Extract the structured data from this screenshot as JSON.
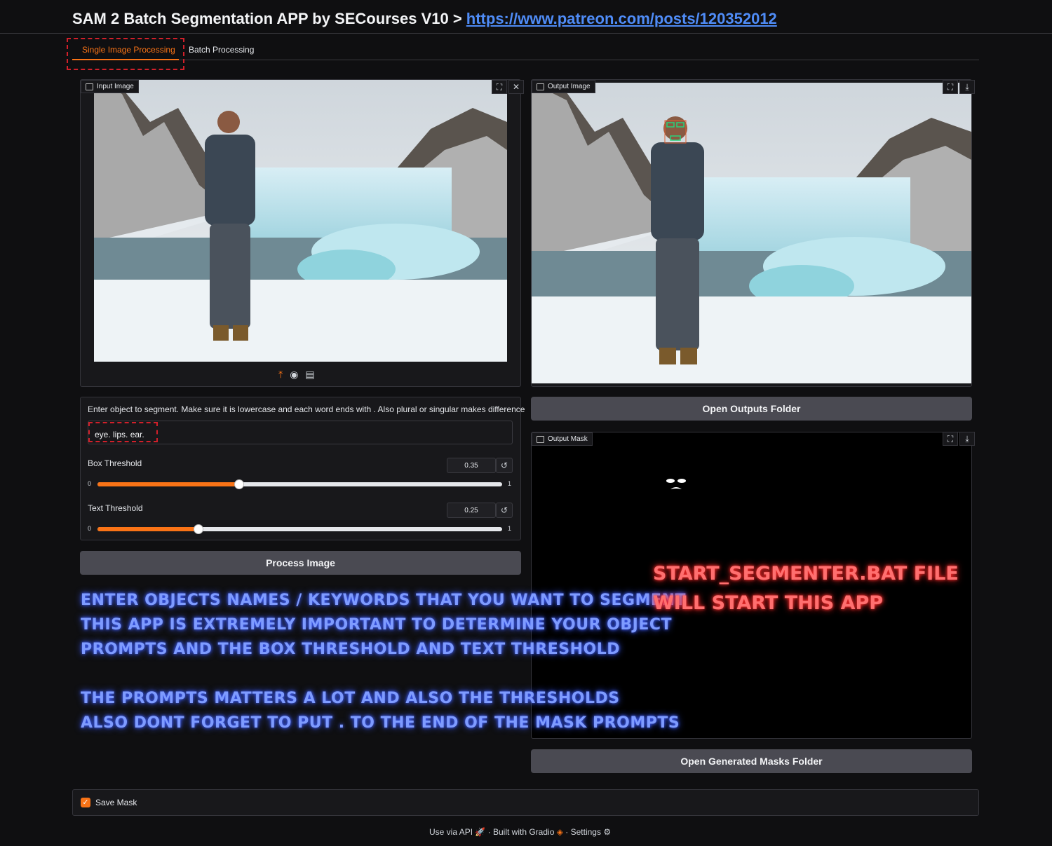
{
  "header": {
    "title": "SAM 2 Batch Segmentation APP by SECourses V10 >",
    "link": "https://www.patreon.com/posts/120352012"
  },
  "tabs": [
    {
      "label": "Single Image Processing",
      "active": true
    },
    {
      "label": "Batch Processing",
      "active": false
    }
  ],
  "input_image": {
    "label": "Input Image",
    "fullscreen_icon": "fullscreen-icon",
    "close_icon": "close-icon",
    "source_icons": [
      "upload-icon",
      "webcam-icon",
      "clipboard-icon"
    ]
  },
  "prompt": {
    "label": "Enter object to segment. Make sure it is lowercase and each word ends with . Also plural or singular makes difference",
    "value": "eye. lips. ear."
  },
  "box_threshold": {
    "label": "Box Threshold",
    "value": "0.35",
    "min": "0",
    "max": "1",
    "fraction": 0.35
  },
  "text_threshold": {
    "label": "Text Threshold",
    "value": "0.25",
    "min": "0",
    "max": "1",
    "fraction": 0.25
  },
  "process_button": "Process Image",
  "output_image": {
    "label": "Output Image"
  },
  "open_outputs_button": "Open Outputs Folder",
  "output_mask": {
    "label": "Output Mask"
  },
  "open_masks_button": "Open Generated Masks Folder",
  "save_mask": {
    "label": "Save Mask",
    "checked": true
  },
  "footer": {
    "api": "Use via API",
    "built": "Built with Gradio",
    "settings": "Settings",
    "separator": "·"
  },
  "annotations": {
    "blue": "Enter objects names / keywords that you want to segment\nthis app is extremely important to determine your object\nprompts and the box threshold and text threshold\n\nthe prompts matters a lot and also the thresholds\nalso dont forget to put . to the end of the mask prompts",
    "red": "start_segmenter.bat file\nwill start this app"
  },
  "colors": {
    "accent": "#f97316",
    "annotation_blue": "#7e9bff",
    "annotation_red": "#ff6f6f",
    "highlight": "#d1202a"
  }
}
